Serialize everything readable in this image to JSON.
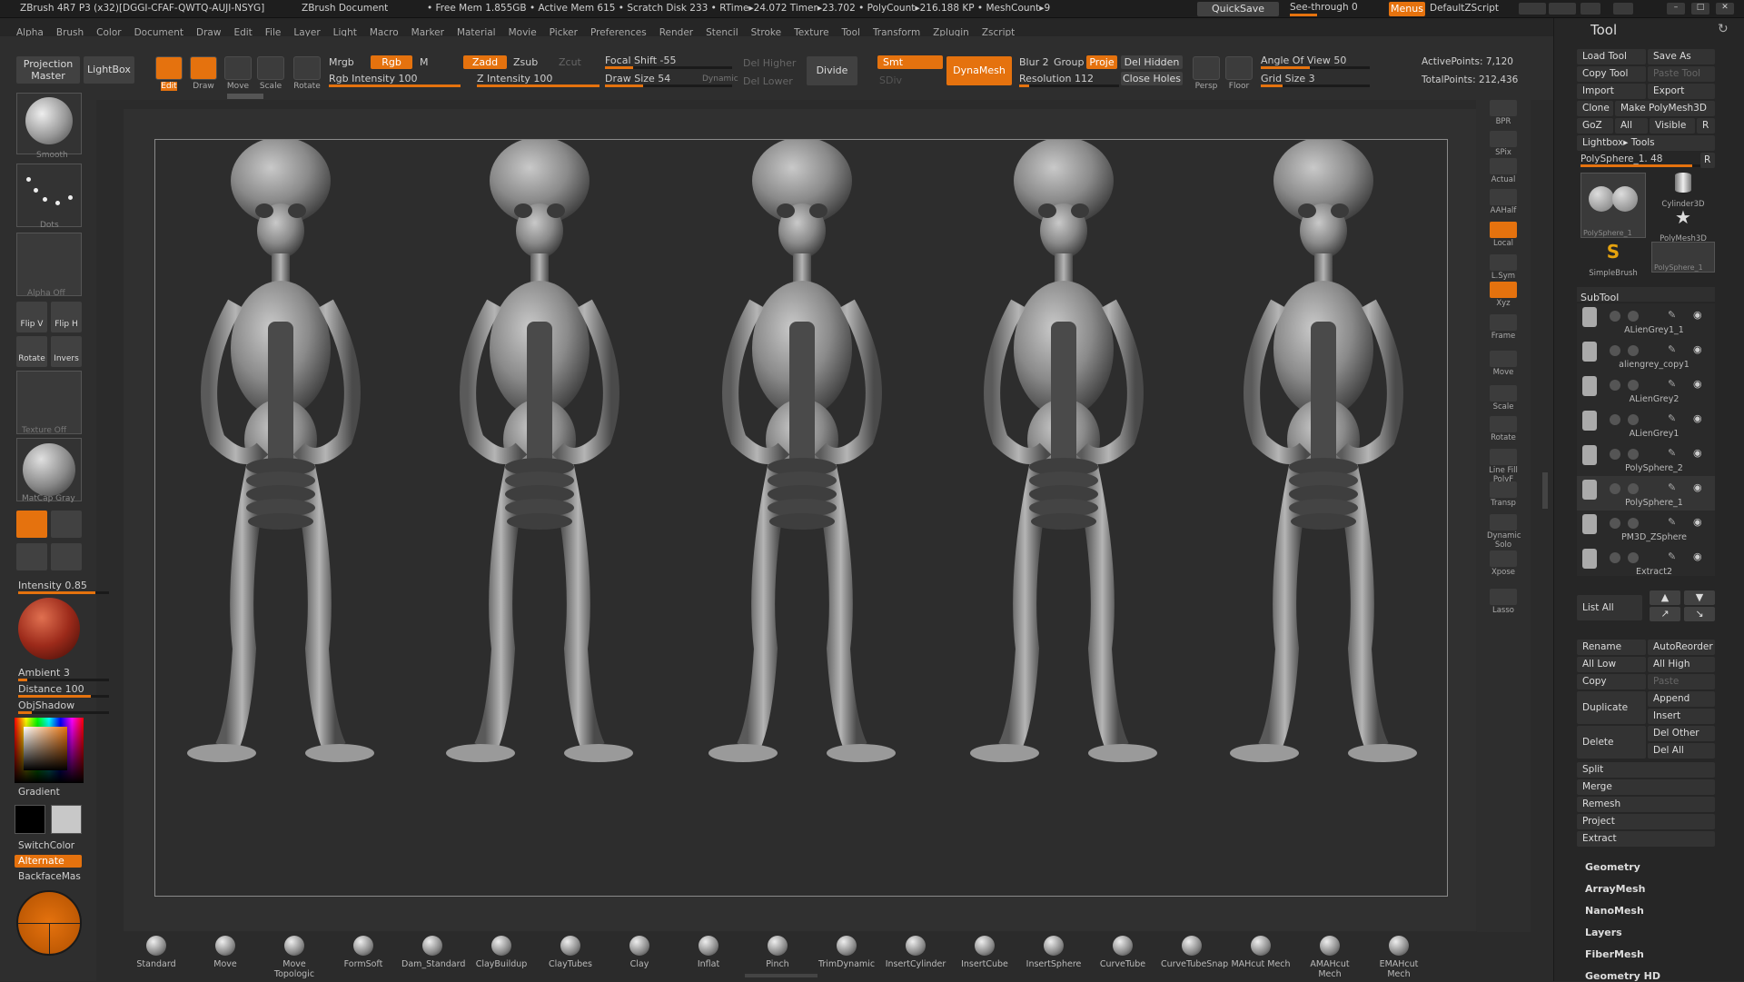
{
  "titlebar": {
    "app": "ZBrush 4R7 P3 (x32)[DGGI-CFAF-QWTQ-AUJI-NSYG]",
    "doc": "ZBrush Document",
    "stats": "• Free Mem 1.855GB • Active Mem 615 • Scratch Disk 233 • RTime▸24.072 Timer▸23.702 • PolyCount▸216.188 KP • MeshCount▸9",
    "quicksave": "QuickSave",
    "seethrough": "See-through  0",
    "menus": "Menus",
    "script": "DefaultZScript"
  },
  "menubar": [
    "Alpha",
    "Brush",
    "Color",
    "Document",
    "Draw",
    "Edit",
    "File",
    "Layer",
    "Light",
    "Macro",
    "Marker",
    "Material",
    "Movie",
    "Picker",
    "Preferences",
    "Render",
    "Stencil",
    "Stroke",
    "Texture",
    "Tool",
    "Transform",
    "Zplugin",
    "Zscript"
  ],
  "toptool": {
    "projection_master": "Projection Master",
    "lightbox": "LightBox",
    "edit": "Edit",
    "draw": "Draw",
    "move": "Move",
    "scale": "Scale",
    "rotate": "Rotate",
    "mrgb": "Mrgb",
    "rgb": "Rgb",
    "m": "M",
    "rgb_intensity": "Rgb Intensity 100",
    "zadd": "Zadd",
    "zsub": "Zsub",
    "zcut": "Zcut",
    "z_intensity": "Z Intensity 100",
    "focal_shift": "Focal Shift -55",
    "draw_size": "Draw Size 54",
    "dynamic": "Dynamic",
    "del_higher": "Del Higher",
    "del_lower": "Del Lower",
    "divide": "Divide",
    "smt": "Smt",
    "sdiv": "SDiv",
    "dynamesh": "DynaMesh",
    "blur": "Blur 2",
    "group": "Group",
    "proje": "Proje",
    "resolution": "Resolution 112",
    "del_hidden": "Del Hidden",
    "close_holes": "Close Holes",
    "persp": "Persp",
    "floor": "Floor",
    "angle_of_view": "Angle Of View 50",
    "grid_size": "Grid Size 3",
    "active_points": "ActivePoints: 7,120",
    "total_points": "TotalPoints: 212,436"
  },
  "leftbar": {
    "smooth": "Smooth",
    "dots": "Dots",
    "alpha_off": "Alpha Off",
    "flip_v": "Flip V",
    "flip_h": "Flip H",
    "rotate": "Rotate",
    "invers": "Invers",
    "texture_off": "Texture Off",
    "matcap": "MatCap Gray",
    "intensity": "Intensity 0.85",
    "ambient": "Ambient 3",
    "distance": "Distance 100",
    "objshadow": "ObjShadow",
    "gradient": "Gradient",
    "switchcolor": "SwitchColor",
    "alternate": "Alternate",
    "backfacemask": "BackfaceMas"
  },
  "rightstrip": [
    "BPR",
    "SPix",
    "Actual",
    "AAHalf",
    "Local",
    "L.Sym",
    "Xyz",
    "Frame",
    "Move",
    "Scale",
    "Rotate",
    "Line Fill PolyF",
    "Transp",
    "Dynamic Solo",
    "Xpose",
    "Lasso"
  ],
  "rightpanel": {
    "title": "Tool",
    "load_tool": "Load Tool",
    "save_as": "Save As",
    "copy_tool": "Copy Tool",
    "paste_tool": "Paste Tool",
    "import": "Import",
    "export": "Export",
    "clone": "Clone",
    "make_polymesh": "Make PolyMesh3D",
    "goz": "GoZ",
    "all": "All",
    "visible": "Visible",
    "r": "R",
    "lightbox_tools": "Lightbox▸ Tools",
    "current_tool": "PolySphere_1. 48",
    "tool_thumbs": [
      "PolySphere_1",
      "Cylinder3D",
      "PolyMesh3D",
      "SimpleBrush",
      "PolySphere_1"
    ],
    "subtool_header": "SubTool",
    "subtools": [
      "ALienGrey1_1",
      "aliengrey_copy1",
      "ALienGrey2",
      "ALienGrey1",
      "PolySphere_2",
      "PolySphere_1",
      "PM3D_ZSphere",
      "Extract2"
    ],
    "list_all": "List All",
    "rename": "Rename",
    "autoreorder": "AutoReorder",
    "all_low": "All Low",
    "all_high": "All High",
    "copy": "Copy",
    "paste": "Paste",
    "duplicate": "Duplicate",
    "append": "Append",
    "insert": "Insert",
    "delete": "Delete",
    "del_other": "Del Other",
    "del_all": "Del All",
    "split": "Split",
    "merge": "Merge",
    "remesh": "Remesh",
    "project": "Project",
    "extract": "Extract",
    "menus": [
      "Geometry",
      "ArrayMesh",
      "NanoMesh",
      "Layers",
      "FiberMesh",
      "Geometry HD"
    ]
  },
  "shelf": [
    "Standard",
    "Move",
    "Move Topologic",
    "FormSoft",
    "Dam_Standard",
    "ClayBuildup",
    "ClayTubes",
    "Clay",
    "Inflat",
    "Pinch",
    "TrimDynamic",
    "InsertCylinder",
    "InsertCube",
    "InsertSphere",
    "CurveTube",
    "CurveTubeSnap",
    "MAHcut Mech",
    "AMAHcut Mech",
    "EMAHcut Mech"
  ],
  "colors": {
    "accent": "#e5720e",
    "bg": "#2b2b2b",
    "panel": "#262626"
  }
}
